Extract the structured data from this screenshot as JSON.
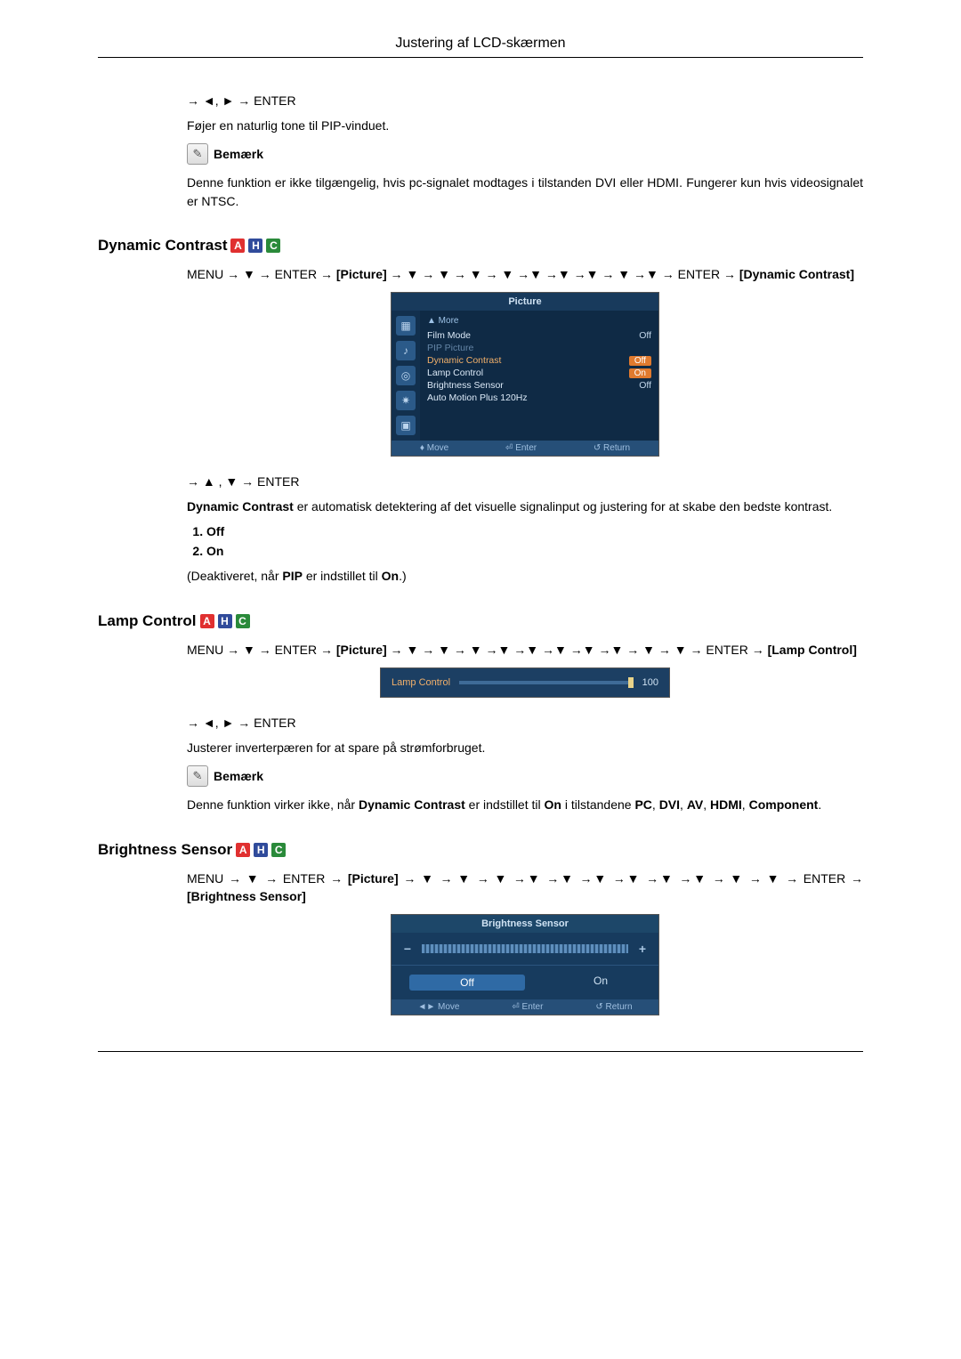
{
  "page_header": "Justering af LCD-skærmen",
  "intro": {
    "nav": "→ ◄, ► → ENTER",
    "desc": "Føjer en naturlig tone til PIP-vinduet.",
    "note_label": "Bemærk",
    "note_body": "Denne funktion er ikke tilgængelig, hvis pc-signalet modtages i tilstanden DVI eller HDMI. Fungerer kun hvis videosignalet er NTSC."
  },
  "badges": {
    "a": "A",
    "h": "H",
    "c": "C"
  },
  "dynamic_contrast": {
    "heading": "Dynamic Contrast",
    "menu_path_pre": "MENU → ▼ → ENTER → ",
    "menu_path_bracket": "[Picture]",
    "menu_path_post": " → ▼ → ▼ → ▼ → ▼ →▼ →▼ →▼ → ▼ →▼ → ENTER → ",
    "menu_path_end": "[Dynamic Contrast]",
    "osd": {
      "title": "Picture",
      "more": "▲ More",
      "rows": [
        {
          "name": "Film Mode",
          "val": "Off",
          "dim": false,
          "hl": false,
          "sel": false
        },
        {
          "name": "PIP Picture",
          "val": "",
          "dim": true,
          "hl": false,
          "sel": false
        },
        {
          "name": "Dynamic Contrast",
          "val": "Off",
          "dim": false,
          "hl": true,
          "sel": true
        },
        {
          "name": "Lamp Control",
          "val": "On",
          "dim": false,
          "hl": true,
          "sel": false
        },
        {
          "name": "Brightness Sensor",
          "val": "Off",
          "dim": false,
          "hl": false,
          "sel": false
        },
        {
          "name": "Auto Motion Plus 120Hz",
          "val": "",
          "dim": false,
          "hl": false,
          "sel": false
        }
      ],
      "footer": {
        "move": "♦ Move",
        "enter": "⏎ Enter",
        "return": "↺ Return"
      }
    },
    "nav2": "→ ▲ , ▼ → ENTER",
    "desc_lead": "Dynamic Contrast",
    "desc_body": " er automatisk detektering af det visuelle signalinput og justering for at skabe den bedste kontrast.",
    "options": [
      "Off",
      "On"
    ],
    "deact_pre": "(Deaktiveret, når ",
    "deact_mid1": "PIP",
    "deact_mid2": " er indstillet til ",
    "deact_mid3": "On",
    "deact_post": ".)"
  },
  "lamp_control": {
    "heading": "Lamp Control",
    "menu_path_pre": "MENU → ▼ → ENTER → ",
    "menu_path_bracket": "[Picture]",
    "menu_path_post": " → ▼ → ▼ → ▼ →▼ →▼ →▼ →▼ →▼ → ▼ → ▼ → ENTER → ",
    "menu_path_end": "[Lamp Control]",
    "osd": {
      "label": "Lamp Control",
      "value": "100"
    },
    "nav2": "→ ◄, ► → ENTER",
    "desc": "Justerer inverterpæren for at spare på strømforbruget.",
    "note_label": "Bemærk",
    "note_body_pre": "Denne funktion virker ikke, når ",
    "note_body_b1": "Dynamic Contrast",
    "note_body_mid": " er indstillet til ",
    "note_body_b2": "On",
    "note_body_mid2": " i tilstandene ",
    "note_body_b3": "PC",
    "note_body_c1": ", ",
    "note_body_b4": "DVI",
    "note_body_c2": ", ",
    "note_body_b5": "AV",
    "note_body_c3": ", ",
    "note_body_b6": "HDMI",
    "note_body_c4": ", ",
    "note_body_b7": "Component",
    "note_body_end": "."
  },
  "brightness_sensor": {
    "heading": "Brightness Sensor",
    "menu_path_pre": "MENU → ▼ → ENTER → ",
    "menu_path_bracket": "[Picture]",
    "menu_path_post": " → ▼ → ▼ → ▼ →▼ →▼ →▼ →▼ →▼ →▼ → ▼ → ▼ → ENTER → ",
    "menu_path_end": "[Brightness Sensor]",
    "osd": {
      "title": "Brightness Sensor",
      "off": "Off",
      "on": "On",
      "footer": {
        "move": "◄► Move",
        "enter": "⏎ Enter",
        "return": "↺ Return"
      }
    }
  }
}
